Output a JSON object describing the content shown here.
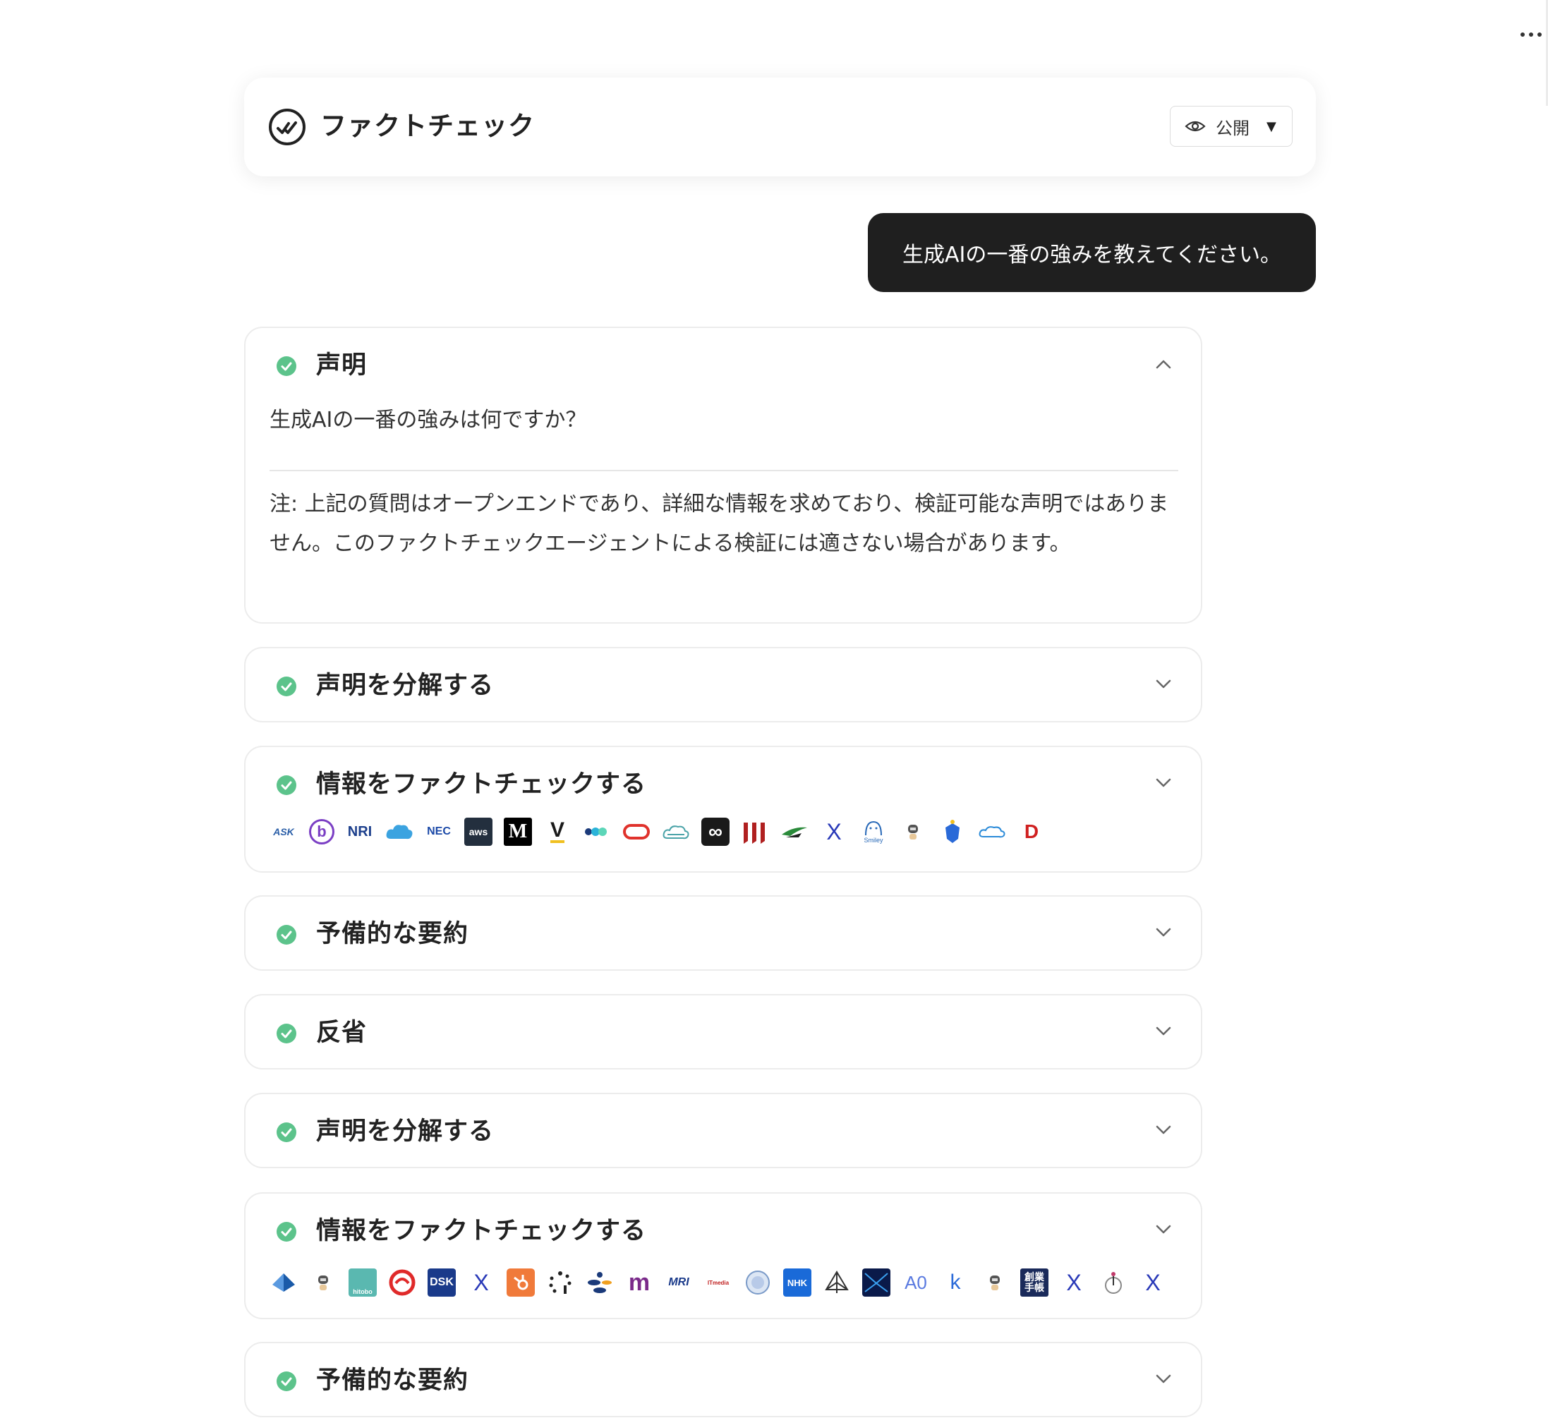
{
  "header": {
    "title": "ファクトチェック",
    "visibility_label": "公開",
    "caret": "▼"
  },
  "user_message": "生成AIの一番の強みを教えてください。",
  "cards": [
    {
      "title": "声明",
      "expanded": true,
      "question": "生成AIの一番の強みは何ですか？",
      "note": "注: 上記の質問はオープンエンドであり、詳細な情報を求めており、検証可能な声明ではありません。このファクトチェックエージェントによる検証には適さない場合があります。"
    },
    {
      "title": "声明を分解する",
      "expanded": false
    },
    {
      "title": "情報をファクトチェックする",
      "expanded": false,
      "sources": [
        {
          "name": "ask-logo",
          "text": "ASK"
        },
        {
          "name": "b-logo",
          "text": "b"
        },
        {
          "name": "nri-logo",
          "text": "NRI"
        },
        {
          "name": "cloud-logo",
          "text": ""
        },
        {
          "name": "nec-logo",
          "text": "NEC"
        },
        {
          "name": "aws-logo",
          "text": "aws"
        },
        {
          "name": "medium-logo",
          "text": "M"
        },
        {
          "name": "v-logo",
          "text": "V"
        },
        {
          "name": "dots-logo",
          "text": "●●"
        },
        {
          "name": "oracle-logo",
          "text": ""
        },
        {
          "name": "cloud-outline-logo",
          "text": ""
        },
        {
          "name": "infinity-logo",
          "text": "∞"
        },
        {
          "name": "bars-logo",
          "text": "III"
        },
        {
          "name": "wing-logo",
          "text": ""
        },
        {
          "name": "x-logo",
          "text": "X"
        },
        {
          "name": "smiley-logo",
          "text": "Smiley"
        },
        {
          "name": "robot-logo",
          "text": ""
        },
        {
          "name": "shield-logo",
          "text": ""
        },
        {
          "name": "cloud-blue-logo",
          "text": ""
        },
        {
          "name": "d-logo",
          "text": "D"
        }
      ]
    },
    {
      "title": "予備的な要約",
      "expanded": false
    },
    {
      "title": "反省",
      "expanded": false
    },
    {
      "title": "声明を分解する",
      "expanded": false
    },
    {
      "title": "情報をファクトチェックする",
      "expanded": false,
      "sources": [
        {
          "name": "pyramid-logo",
          "text": ""
        },
        {
          "name": "robot-logo",
          "text": ""
        },
        {
          "name": "hitobo-logo",
          "text": "hitobo"
        },
        {
          "name": "swirl-logo",
          "text": ""
        },
        {
          "name": "dsk-logo",
          "text": "DSK"
        },
        {
          "name": "x-logo",
          "text": "X"
        },
        {
          "name": "hubspot-logo",
          "text": ""
        },
        {
          "name": "spinner-logo",
          "text": ""
        },
        {
          "name": "dots-logo",
          "text": ""
        },
        {
          "name": "m-logo",
          "text": "m"
        },
        {
          "name": "mri-logo",
          "text": "MRI"
        },
        {
          "name": "itmedia-logo",
          "text": "ITmedia"
        },
        {
          "name": "globe-logo",
          "text": ""
        },
        {
          "name": "nhk-logo",
          "text": "NHK"
        },
        {
          "name": "tent-logo",
          "text": ""
        },
        {
          "name": "envelope-logo",
          "text": ""
        },
        {
          "name": "ao-logo",
          "text": "A0"
        },
        {
          "name": "k-logo",
          "text": "k"
        },
        {
          "name": "robot-logo",
          "text": ""
        },
        {
          "name": "sogyo-techo-logo",
          "text": "創業手帳"
        },
        {
          "name": "x-logo",
          "text": "X"
        },
        {
          "name": "figure-logo",
          "text": ""
        },
        {
          "name": "x-logo",
          "text": "X"
        }
      ]
    },
    {
      "title": "予備的な要約",
      "expanded": false
    }
  ]
}
